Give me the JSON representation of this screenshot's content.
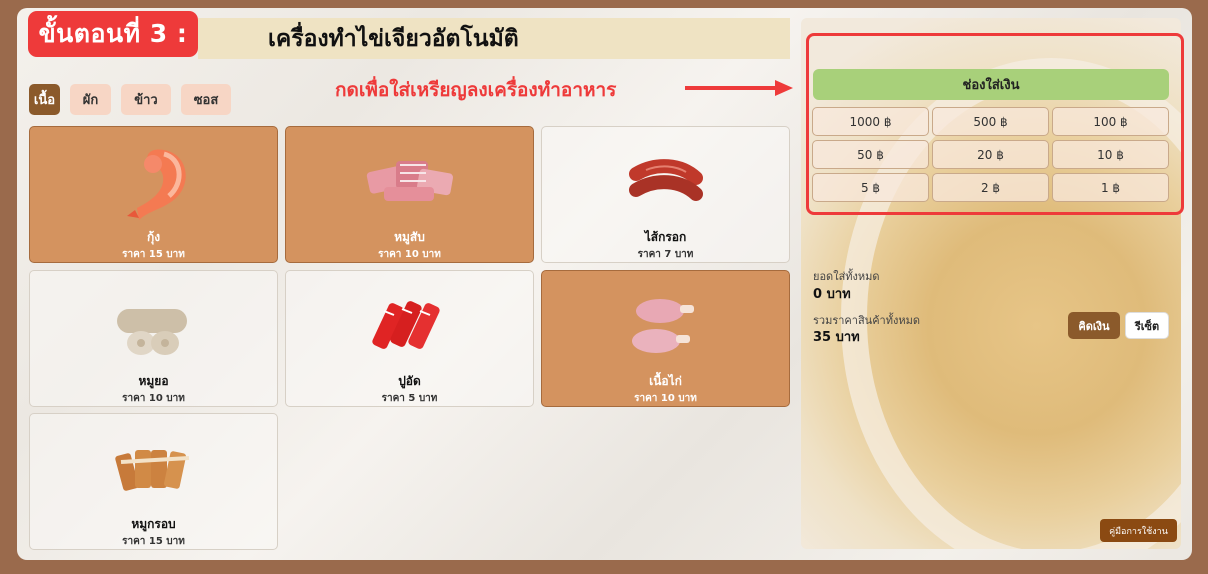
{
  "header": {
    "step": "ขั้นตอนที่ 3 :",
    "title": "เครื่องทำไข่เจียวอัตโนมัติ"
  },
  "tabs": [
    {
      "label": "เนื้อ",
      "active": true
    },
    {
      "label": "ผัก",
      "active": false
    },
    {
      "label": "ข้าว",
      "active": false
    },
    {
      "label": "ซอส",
      "active": false
    }
  ],
  "hint": "กดเพื่อใส่เหรียญลงเครื่องทำอาหาร",
  "items": [
    {
      "name": "กุ้ง",
      "price": "ราคา 15 บาท",
      "icon": "shrimp-icon",
      "selected": true
    },
    {
      "name": "หมูสับ",
      "price": "ราคา 10 บาท",
      "icon": "minced-pork-icon",
      "selected": true
    },
    {
      "name": "ไส้กรอก",
      "price": "ราคา 7 บาท",
      "icon": "sausage-icon",
      "selected": false
    },
    {
      "name": "หมูยอ",
      "price": "ราคา 10 บาท",
      "icon": "pork-roll-icon",
      "selected": false
    },
    {
      "name": "ปูอัด",
      "price": "ราคา 5 บาท",
      "icon": "crab-stick-icon",
      "selected": false
    },
    {
      "name": "เนื้อไก่",
      "price": "ราคา 10 บาท",
      "icon": "chicken-icon",
      "selected": true
    },
    {
      "name": "หมูกรอบ",
      "price": "ราคา 15 บาท",
      "icon": "crispy-pork-icon",
      "selected": false
    }
  ],
  "money": {
    "header": "ช่องใส่เงิน",
    "coins": [
      "1000 ฿",
      "500 ฿",
      "100 ฿",
      "50 ฿",
      "20 ฿",
      "10 ฿",
      "5 ฿",
      "2 ฿",
      "1 ฿"
    ]
  },
  "summary": {
    "deposit_label": "ยอดใส่ทั้งหมด",
    "deposit_value": "0 บาท",
    "total_label": "รวมราคาสินค้าทั้งหมด",
    "total_value": "35 บาท"
  },
  "buttons": {
    "checkout": "คิดเงิน",
    "reset": "รีเซ็ต",
    "manual": "คู่มือการใช้งาน"
  },
  "colors": {
    "accent_red": "#ee3a3a",
    "brown": "#8b5a2b",
    "selected_card": "#d4935f",
    "money_header": "#a8d07a"
  }
}
